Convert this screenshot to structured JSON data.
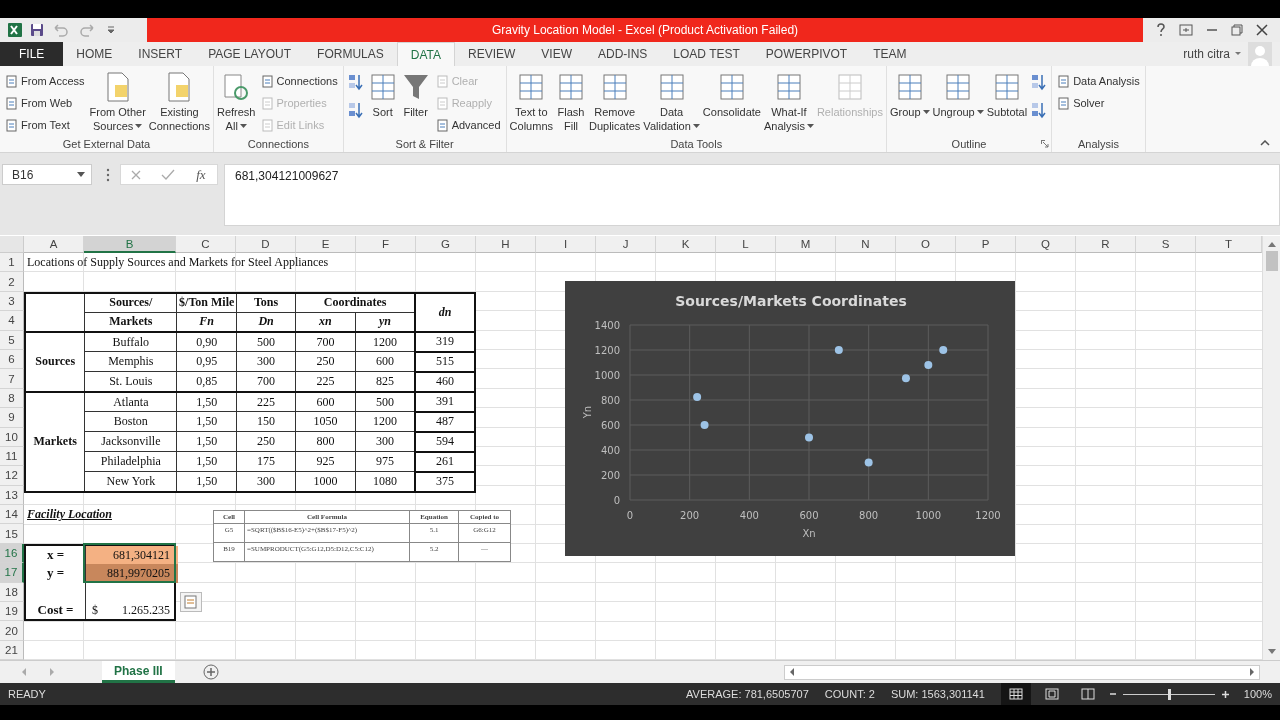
{
  "title_bar": {
    "title": "Gravity Location Model -  Excel (Product Activation Failed)"
  },
  "ribbon_tabs": [
    {
      "label": "FILE",
      "kind": "file",
      "selected": false
    },
    {
      "label": "HOME",
      "kind": "tab",
      "selected": false
    },
    {
      "label": "INSERT",
      "kind": "tab",
      "selected": false
    },
    {
      "label": "PAGE LAYOUT",
      "kind": "tab",
      "selected": false
    },
    {
      "label": "FORMULAS",
      "kind": "tab",
      "selected": false
    },
    {
      "label": "DATA",
      "kind": "tab",
      "selected": true
    },
    {
      "label": "REVIEW",
      "kind": "tab",
      "selected": false
    },
    {
      "label": "VIEW",
      "kind": "tab",
      "selected": false
    },
    {
      "label": "ADD-INS",
      "kind": "tab",
      "selected": false
    },
    {
      "label": "LOAD TEST",
      "kind": "tab",
      "selected": false
    },
    {
      "label": "POWERPIVOT",
      "kind": "tab",
      "selected": false
    },
    {
      "label": "TEAM",
      "kind": "tab",
      "selected": false
    }
  ],
  "account": {
    "user": "ruth citra"
  },
  "ribbon_groups": [
    {
      "label": "Get External Data",
      "launcher": false,
      "controls": [
        {
          "kind": "stack",
          "buttons": [
            {
              "label": "From Access",
              "disabled": false
            },
            {
              "label": "From Web",
              "disabled": false
            },
            {
              "label": "From Text",
              "disabled": false
            }
          ]
        },
        {
          "kind": "large",
          "lines": [
            "From Other",
            "Sources"
          ],
          "dropdown": true,
          "disabled": false
        },
        {
          "kind": "large",
          "lines": [
            "Existing",
            "Connections"
          ],
          "dropdown": false,
          "disabled": false
        }
      ]
    },
    {
      "label": "Connections",
      "launcher": false,
      "controls": [
        {
          "kind": "large",
          "lines": [
            "Refresh",
            "All"
          ],
          "dropdown": true,
          "disabled": false
        },
        {
          "kind": "stack",
          "buttons": [
            {
              "label": "Connections",
              "disabled": false
            },
            {
              "label": "Properties",
              "disabled": true
            },
            {
              "label": "Edit Links",
              "disabled": true
            }
          ]
        }
      ]
    },
    {
      "label": "Sort & Filter",
      "launcher": false,
      "controls": [
        {
          "kind": "icon_stack"
        },
        {
          "kind": "large",
          "lines": [
            "Sort"
          ],
          "dropdown": false,
          "disabled": false
        },
        {
          "kind": "large",
          "lines": [
            "Filter"
          ],
          "dropdown": false,
          "disabled": false
        },
        {
          "kind": "stack",
          "buttons": [
            {
              "label": "Clear",
              "disabled": true
            },
            {
              "label": "Reapply",
              "disabled": true
            },
            {
              "label": "Advanced",
              "disabled": false
            }
          ]
        }
      ]
    },
    {
      "label": "Data Tools",
      "launcher": false,
      "controls": [
        {
          "kind": "large",
          "lines": [
            "Text to",
            "Columns"
          ],
          "dropdown": false,
          "disabled": false
        },
        {
          "kind": "large",
          "lines": [
            "Flash",
            "Fill"
          ],
          "dropdown": false,
          "disabled": false
        },
        {
          "kind": "large",
          "lines": [
            "Remove",
            "Duplicates"
          ],
          "dropdown": false,
          "disabled": false
        },
        {
          "kind": "large",
          "lines": [
            "Data",
            "Validation"
          ],
          "dropdown": true,
          "disabled": false
        },
        {
          "kind": "large",
          "lines": [
            "Consolidate"
          ],
          "dropdown": false,
          "disabled": false
        },
        {
          "kind": "large",
          "lines": [
            "What-If",
            "Analysis"
          ],
          "dropdown": true,
          "disabled": false
        },
        {
          "kind": "large",
          "lines": [
            "Relationships"
          ],
          "dropdown": false,
          "disabled": true
        }
      ]
    },
    {
      "label": "Outline",
      "launcher": true,
      "controls": [
        {
          "kind": "large",
          "lines": [
            "Group"
          ],
          "dropdown": true,
          "disabled": false
        },
        {
          "kind": "large",
          "lines": [
            "Ungroup"
          ],
          "dropdown": true,
          "disabled": false
        },
        {
          "kind": "large",
          "lines": [
            "Subtotal"
          ],
          "dropdown": false,
          "disabled": false
        },
        {
          "kind": "icon_stack"
        }
      ]
    },
    {
      "label": "Analysis",
      "launcher": false,
      "controls": [
        {
          "kind": "stack",
          "buttons": [
            {
              "label": "Data Analysis",
              "disabled": false
            },
            {
              "label": "Solver",
              "disabled": false
            }
          ]
        }
      ]
    }
  ],
  "formula_bar": {
    "name_box": "B16",
    "insert_function": "fx",
    "value": "681,304121009627"
  },
  "columns": [
    {
      "label": "A",
      "selected": false
    },
    {
      "label": "B",
      "selected": true
    },
    {
      "label": "C",
      "selected": false
    },
    {
      "label": "D",
      "selected": false
    },
    {
      "label": "E",
      "selected": false
    },
    {
      "label": "F",
      "selected": false
    },
    {
      "label": "G",
      "selected": false
    },
    {
      "label": "H",
      "selected": false
    },
    {
      "label": "I",
      "selected": false
    },
    {
      "label": "J",
      "selected": false
    },
    {
      "label": "K",
      "selected": false
    },
    {
      "label": "L",
      "selected": false
    },
    {
      "label": "M",
      "selected": false
    },
    {
      "label": "N",
      "selected": false
    },
    {
      "label": "O",
      "selected": false
    },
    {
      "label": "P",
      "selected": false
    },
    {
      "label": "Q",
      "selected": false
    },
    {
      "label": "R",
      "selected": false
    },
    {
      "label": "S",
      "selected": false
    },
    {
      "label": "T",
      "selected": false
    }
  ],
  "rows": [
    {
      "label": "1",
      "selected": false
    },
    {
      "label": "2",
      "selected": false
    },
    {
      "label": "3",
      "selected": false
    },
    {
      "label": "4",
      "selected": false
    },
    {
      "label": "5",
      "selected": false
    },
    {
      "label": "6",
      "selected": false
    },
    {
      "label": "7",
      "selected": false
    },
    {
      "label": "8",
      "selected": false
    },
    {
      "label": "9",
      "selected": false
    },
    {
      "label": "10",
      "selected": false
    },
    {
      "label": "11",
      "selected": false
    },
    {
      "label": "12",
      "selected": false
    },
    {
      "label": "13",
      "selected": false
    },
    {
      "label": "14",
      "selected": false
    },
    {
      "label": "15",
      "selected": false
    },
    {
      "label": "16",
      "selected": true
    },
    {
      "label": "17",
      "selected": true
    },
    {
      "label": "18",
      "selected": false
    },
    {
      "label": "19",
      "selected": false
    },
    {
      "label": "20",
      "selected": false
    },
    {
      "label": "21",
      "selected": false
    }
  ],
  "sheet_title": "Locations of Supply Sources and Markets for Steel Appliances",
  "data_table": {
    "headers": {
      "name_top": "Sources/",
      "name_bottom": "Markets",
      "cost_top": "$/Ton Mile",
      "cost_bottom": "Fn",
      "tons_top": "Tons",
      "tons_bottom": "Dn",
      "coordinates": "Coordinates",
      "x": "xn",
      "y": "yn",
      "distance": "dn"
    },
    "groups": [
      {
        "label": "Sources",
        "rows": [
          {
            "name": "Buffalo",
            "fn": "0,90",
            "dn": "500",
            "xn": "700",
            "yn": "1200",
            "distance": "319"
          },
          {
            "name": "Memphis",
            "fn": "0,95",
            "dn": "300",
            "xn": "250",
            "yn": "600",
            "distance": "515"
          },
          {
            "name": "St. Louis",
            "fn": "0,85",
            "dn": "700",
            "xn": "225",
            "yn": "825",
            "distance": "460"
          }
        ]
      },
      {
        "label": "Markets",
        "rows": [
          {
            "name": "Atlanta",
            "fn": "1,50",
            "dn": "225",
            "xn": "600",
            "yn": "500",
            "distance": "391"
          },
          {
            "name": "Boston",
            "fn": "1,50",
            "dn": "150",
            "xn": "1050",
            "yn": "1200",
            "distance": "487"
          },
          {
            "name": "Jacksonville",
            "fn": "1,50",
            "dn": "250",
            "xn": "800",
            "yn": "300",
            "distance": "594"
          },
          {
            "name": "Philadelphia",
            "fn": "1,50",
            "dn": "175",
            "xn": "925",
            "yn": "975",
            "distance": "261"
          },
          {
            "name": "New York",
            "fn": "1,50",
            "dn": "300",
            "xn": "1000",
            "yn": "1080",
            "distance": "375"
          }
        ]
      }
    ]
  },
  "facility": {
    "heading": "Facility Location",
    "x_label": "x =",
    "x_value": "681,304121",
    "y_label": "y =",
    "y_value": "881,9970205",
    "cost_label": "Cost =",
    "currency": "$",
    "cost_value": "1.265.235"
  },
  "formula_table": {
    "columns": [
      "Cell",
      "Cell Formula",
      "Equation",
      "Copied to"
    ],
    "rows": [
      [
        "G5",
        "=SQRT(($B$16-E5)^2+($B$17-F5)^2)",
        "5.1",
        "G6:G12"
      ],
      [
        "B19",
        "=SUMPRODUCT(G5:G12,D5:D12,C5:C12)",
        "5.2",
        "—"
      ]
    ]
  },
  "chart": {
    "chart_data": {
      "type": "scatter",
      "title": "Sources/Markets Coordinates",
      "xlabel": "Xn",
      "ylabel": "Yn",
      "x": [
        700,
        250,
        225,
        600,
        1050,
        800,
        925,
        1000
      ],
      "series": [
        {
          "color": "#9dc3e6",
          "values": [
            1200,
            600,
            825,
            500,
            1200,
            300,
            975,
            1080
          ]
        }
      ],
      "grid": true,
      "xlim": [
        0,
        1200
      ],
      "ylim": [
        0,
        1400
      ],
      "xticks": [
        0,
        200,
        400,
        600,
        800,
        1000,
        1200
      ],
      "yticks": [
        0,
        200,
        400,
        600,
        800,
        1000,
        1200,
        1400
      ]
    }
  },
  "sheet_tabs": [
    {
      "label": "Phase III",
      "selected": true
    }
  ],
  "status_bar": {
    "mode": "READY",
    "average": "AVERAGE: 781,6505707",
    "count": "COUNT: 2",
    "sum": "SUM: 1563,301141",
    "views": [
      {
        "selected": true
      },
      {
        "selected": false
      },
      {
        "selected": false
      }
    ],
    "zoom": {
      "level": 0.5,
      "reading": "100%"
    }
  }
}
